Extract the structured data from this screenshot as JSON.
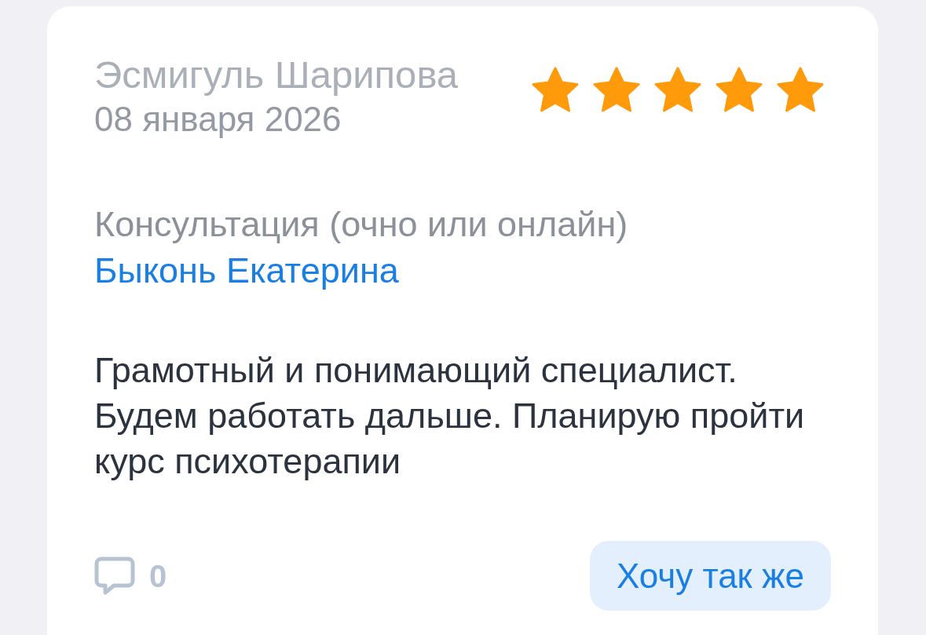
{
  "review": {
    "author": "Эсмигуль Шарипова",
    "date": "08 января 2026",
    "stars": 5,
    "service": "Консультация (очно или онлайн)",
    "specialist": "Быконь Екатерина",
    "text": "Грамотный и понимающий специалист. Будем работать дальше. Планирую пройти курс психотерапии",
    "comments_count": "0",
    "action_button": "Хочу так же"
  }
}
